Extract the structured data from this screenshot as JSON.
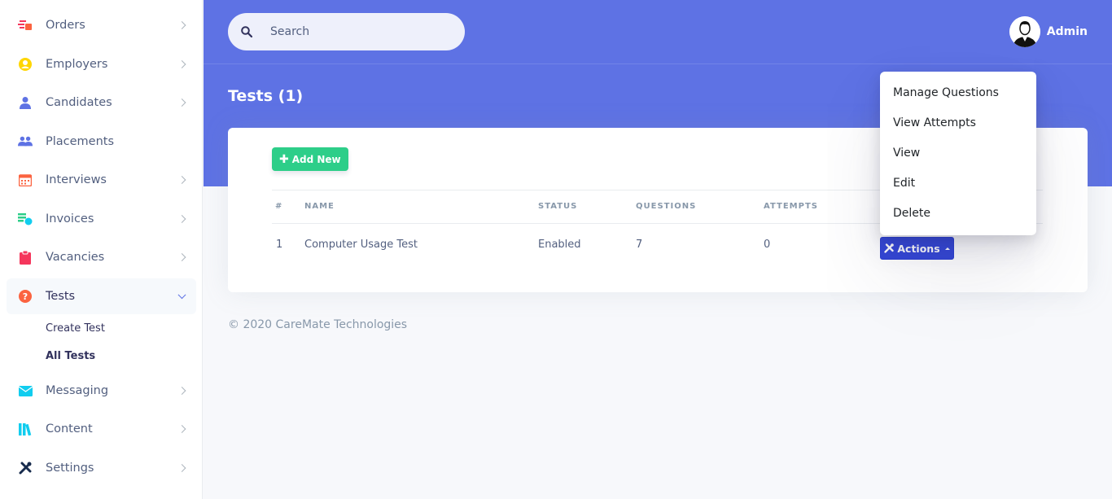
{
  "sidebar": {
    "items": [
      {
        "label": "Orders",
        "icon": "orders-icon",
        "color": "#f5365c"
      },
      {
        "label": "Employers",
        "icon": "employers-icon",
        "color": "#ffd600"
      },
      {
        "label": "Candidates",
        "icon": "candidates-icon",
        "color": "#5e72e4"
      },
      {
        "label": "Placements",
        "icon": "placements-icon",
        "color": "#5e72e4"
      },
      {
        "label": "Interviews",
        "icon": "calendar-icon",
        "color": "#fb6340"
      },
      {
        "label": "Invoices",
        "icon": "invoices-icon",
        "color": "#2dce89"
      },
      {
        "label": "Vacancies",
        "icon": "clipboard-icon",
        "color": "#f5365c"
      },
      {
        "label": "Tests",
        "icon": "question-icon",
        "color": "#fb6340"
      },
      {
        "label": "Messaging",
        "icon": "envelope-icon",
        "color": "#11cdef"
      },
      {
        "label": "Content",
        "icon": "books-icon",
        "color": "#11cdef"
      },
      {
        "label": "Settings",
        "icon": "tools-icon",
        "color": "#172b4d"
      }
    ],
    "tests_sub": [
      {
        "label": "Create Test"
      },
      {
        "label": "All Tests"
      }
    ]
  },
  "header": {
    "search_placeholder": "Search",
    "user_name": "Admin",
    "page_title": "Tests (1)",
    "accent": "#5e72e4"
  },
  "card": {
    "add_new_label": "Add New",
    "columns": [
      "#",
      "Name",
      "Status",
      "Questions",
      "Attempts"
    ],
    "rows": [
      {
        "num": "1",
        "name": "Computer Usage Test",
        "status": "Enabled",
        "questions": "7",
        "attempts": "0"
      }
    ],
    "actions_label": "Actions"
  },
  "dropdown": {
    "items": [
      "Manage Questions",
      "View Attempts",
      "View",
      "Edit",
      "Delete"
    ]
  },
  "footer": {
    "text": "© 2020 CareMate Technologies"
  }
}
